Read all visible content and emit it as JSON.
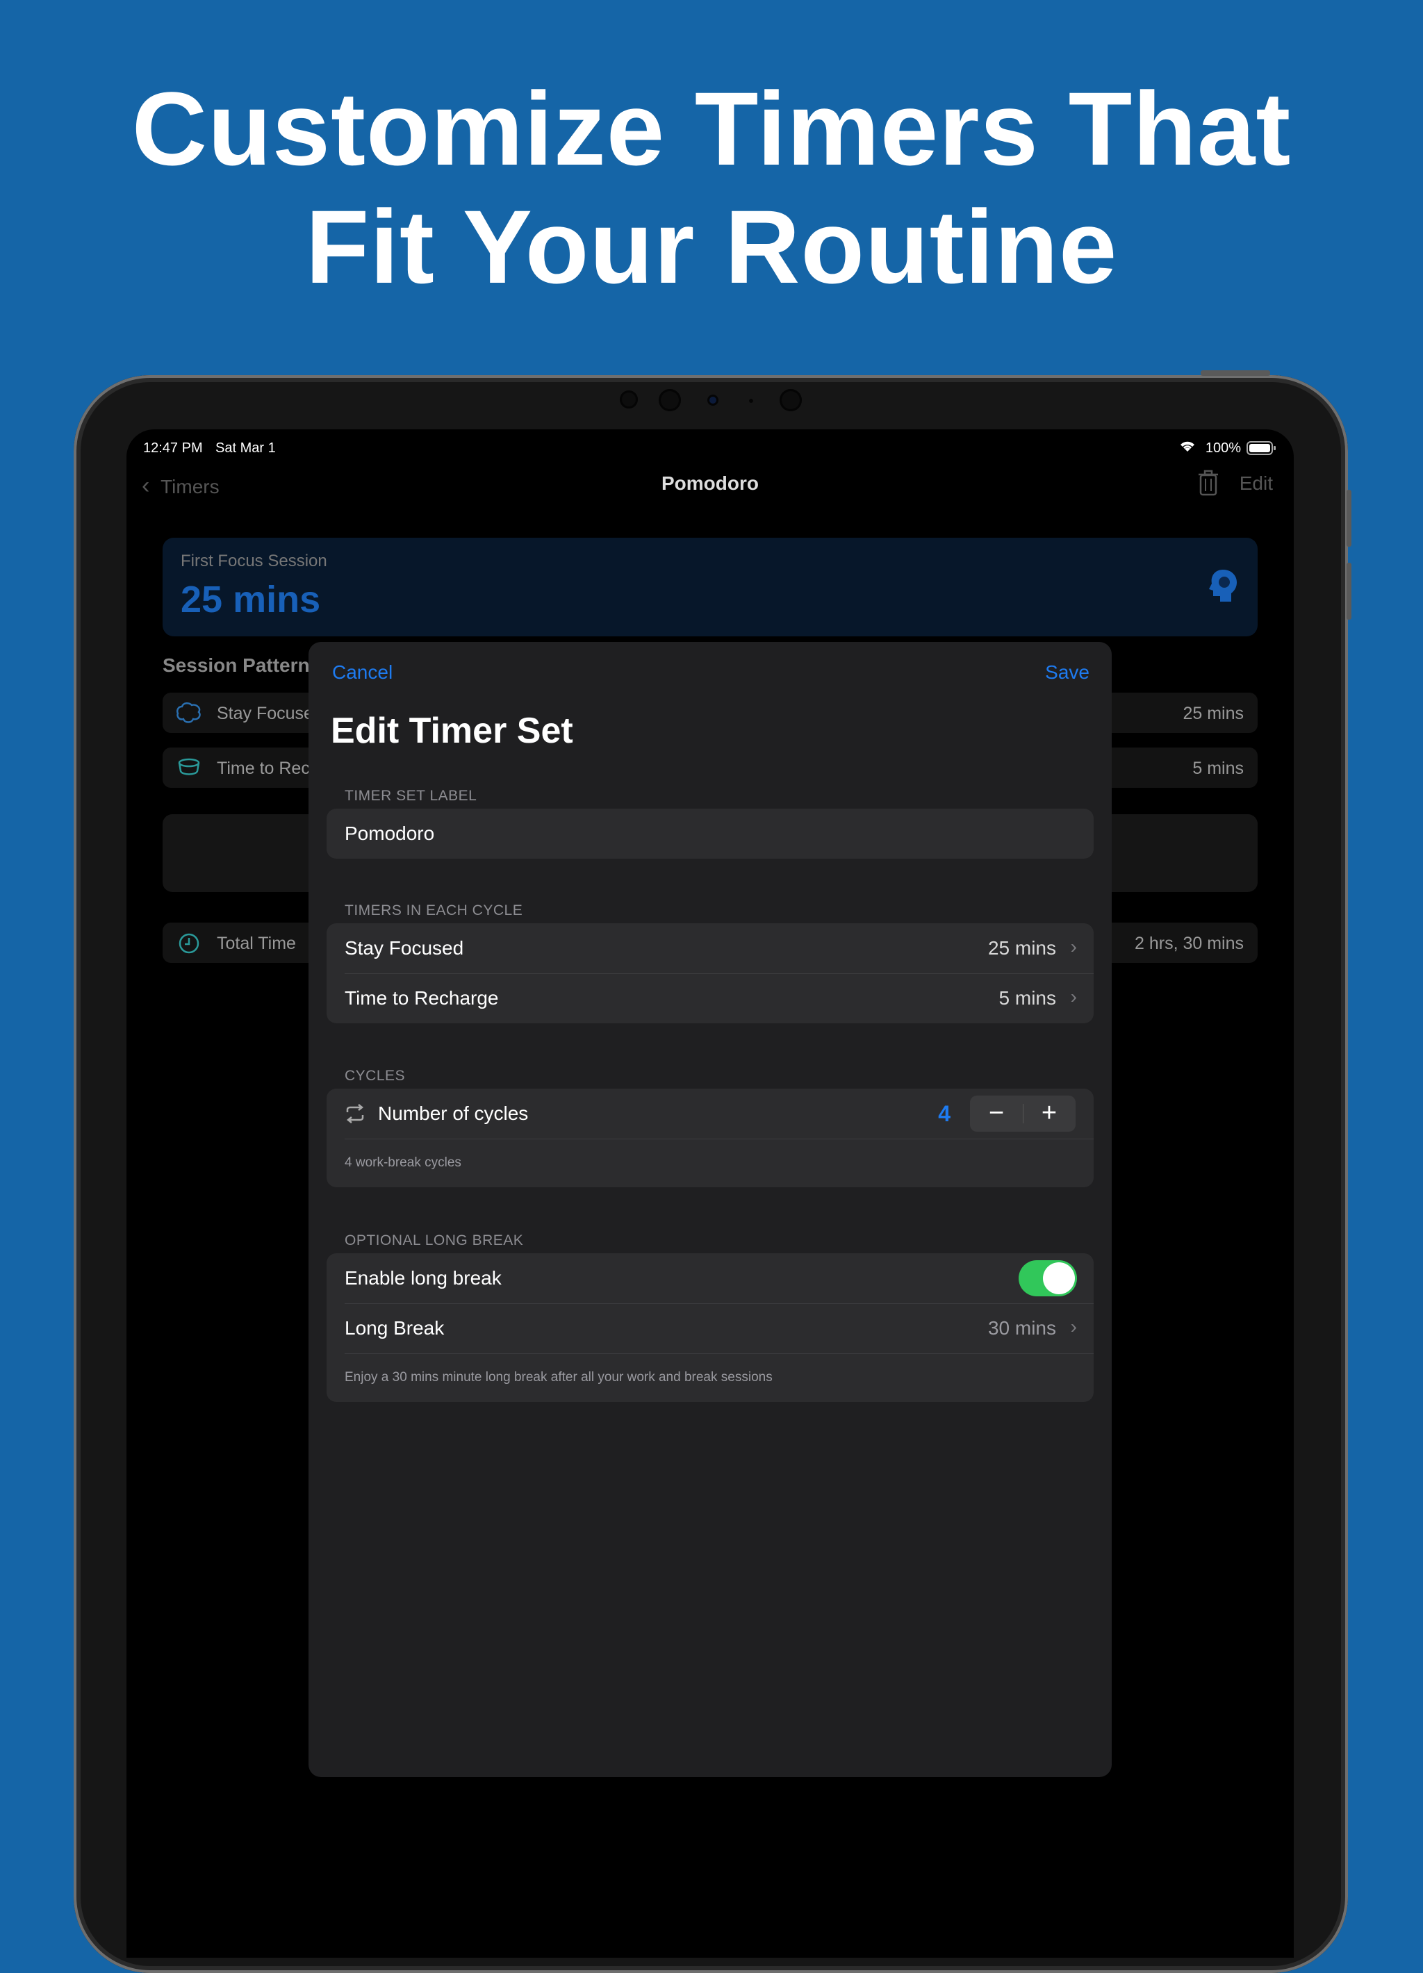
{
  "headline": {
    "line1": "Customize Timers That",
    "line2": "Fit Your Routine"
  },
  "status_bar": {
    "time": "12:47 PM",
    "date": "Sat Mar 1",
    "battery": "100%"
  },
  "nav": {
    "back_label": "Timers",
    "title": "Pomodoro",
    "edit_label": "Edit"
  },
  "focus_card": {
    "label": "First Focus Session",
    "value": "25 mins"
  },
  "background": {
    "session_pattern_title": "Session Pattern",
    "rows": [
      {
        "label": "Stay Focuse",
        "value": "25 mins"
      },
      {
        "label": "Time to Rec",
        "value": "5 mins"
      }
    ],
    "total": {
      "label": "Total Time",
      "value": "2 hrs, 30 mins"
    }
  },
  "sheet": {
    "cancel_label": "Cancel",
    "save_label": "Save",
    "title": "Edit Timer Set",
    "label_section": {
      "header": "TIMER SET LABEL",
      "value": "Pomodoro"
    },
    "timers_section": {
      "header": "TIMERS IN EACH CYCLE",
      "rows": [
        {
          "label": "Stay Focused",
          "value": "25 mins"
        },
        {
          "label": "Time to Recharge",
          "value": "5 mins"
        }
      ]
    },
    "cycles_section": {
      "header": "CYCLES",
      "label": "Number of cycles",
      "count": "4",
      "minus": "−",
      "plus": "+",
      "note": "4 work-break cycles"
    },
    "long_break_section": {
      "header": "OPTIONAL LONG BREAK",
      "enable_label": "Enable long break",
      "enabled": true,
      "break_label": "Long Break",
      "break_value": "30 mins",
      "note": "Enjoy a 30 mins minute long break after all your work and break sessions"
    }
  },
  "colors": {
    "accent": "#1e7bf0",
    "background": "#1565a7",
    "toggle_on": "#31c75a"
  }
}
